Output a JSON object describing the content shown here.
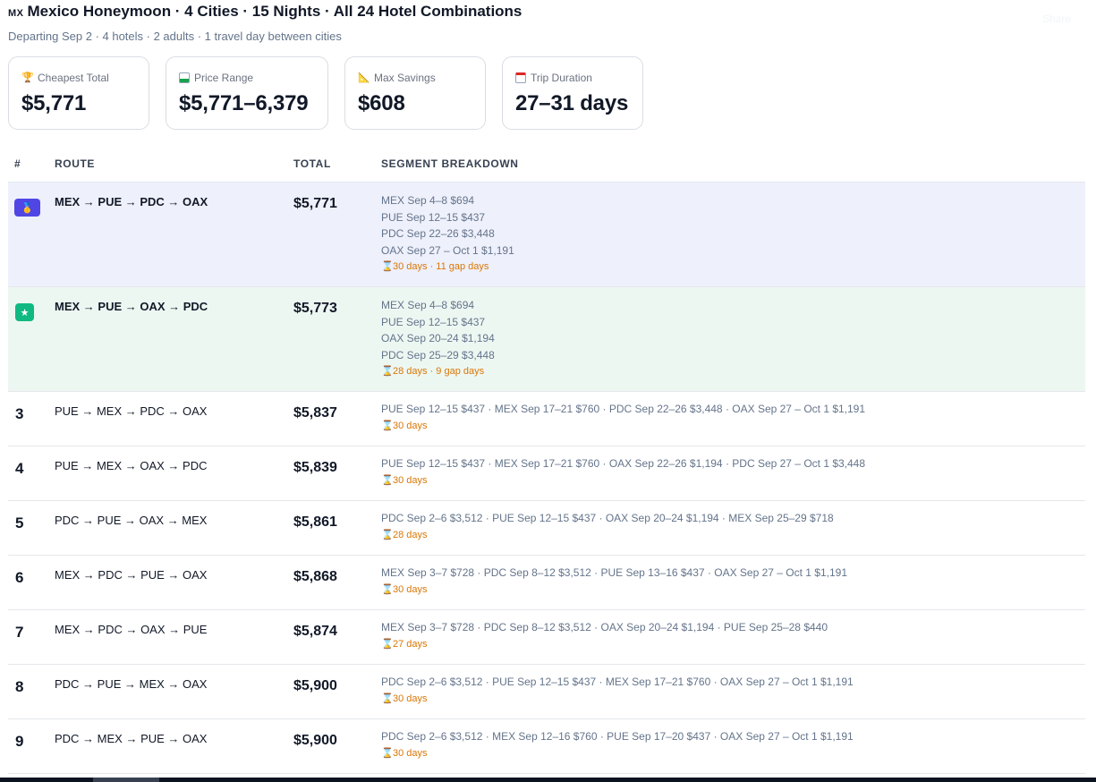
{
  "header": {
    "flag": "MX",
    "title": "Mexico Honeymoon · 4 Cities · 15 Nights · All 24 Hotel Combinations",
    "subtitle": "Departing Sep 2 · 4 hotels · 2 adults · 1 travel day between cities",
    "share_label": "Share"
  },
  "stats": [
    {
      "icon": "trophy-icon",
      "label": "Cheapest Total",
      "value": "$5,771"
    },
    {
      "icon": "bar-chart-icon",
      "label": "Price Range",
      "value": "$5,771–6,379"
    },
    {
      "icon": "ruler-icon",
      "label": "Max Savings",
      "value": "$608"
    },
    {
      "icon": "calendar-icon",
      "label": "Trip Duration",
      "value": "27–31 days"
    }
  ],
  "table": {
    "columns": {
      "rank": "#",
      "route": "ROUTE",
      "total": "TOTAL",
      "segments": "SEGMENT BREAKDOWN"
    },
    "rows": [
      {
        "rank": "1",
        "badge": "medal-icon",
        "route": "MEX → PUE → PDC → OAX",
        "total": "$5,771",
        "segments": [
          "MEX Sep 4–8 $694",
          "PUE Sep 12–15 $437",
          "PDC Sep 22–26 $3,448",
          "OAX Sep 27 – Oct 1 $1,191"
        ],
        "duration": "30 days · 11 gap days"
      },
      {
        "rank": "2",
        "badge": "star-icon",
        "route": "MEX → PUE → OAX → PDC",
        "total": "$5,773",
        "segments": [
          "MEX Sep 4–8 $694",
          "PUE Sep 12–15 $437",
          "OAX Sep 20–24 $1,194",
          "PDC Sep 25–29 $3,448"
        ],
        "duration": "28 days · 9 gap days"
      },
      {
        "rank": "3",
        "route": "PUE → MEX → PDC → OAX",
        "total": "$5,837",
        "segments_line": "PUE Sep 12–15 $437 · MEX Sep 17–21 $760 · PDC Sep 22–26 $3,448 · OAX Sep 27 – Oct 1 $1,191",
        "duration": "30 days"
      },
      {
        "rank": "4",
        "route": "PUE → MEX → OAX → PDC",
        "total": "$5,839",
        "segments_line": "PUE Sep 12–15 $437 · MEX Sep 17–21 $760 · OAX Sep 22–26 $1,194 · PDC Sep 27 – Oct 1 $3,448",
        "duration": "30 days"
      },
      {
        "rank": "5",
        "route": "PDC → PUE → OAX → MEX",
        "total": "$5,861",
        "segments_line": "PDC Sep 2–6 $3,512 · PUE Sep 12–15 $437 · OAX Sep 20–24 $1,194 · MEX Sep 25–29 $718",
        "duration": "28 days"
      },
      {
        "rank": "6",
        "route": "MEX → PDC → PUE → OAX",
        "total": "$5,868",
        "segments_line": "MEX Sep 3–7 $728 · PDC Sep 8–12 $3,512 · PUE Sep 13–16 $437 · OAX Sep 27 – Oct 1 $1,191",
        "duration": "30 days"
      },
      {
        "rank": "7",
        "route": "MEX → PDC → OAX → PUE",
        "total": "$5,874",
        "segments_line": "MEX Sep 3–7 $728 · PDC Sep 8–12 $3,512 · OAX Sep 20–24 $1,194 · PUE Sep 25–28 $440",
        "duration": "27 days"
      },
      {
        "rank": "8",
        "route": "PDC → PUE → MEX → OAX",
        "total": "$5,900",
        "segments_line": "PDC Sep 2–6 $3,512 · PUE Sep 12–15 $437 · MEX Sep 17–21 $760 · OAX Sep 27 – Oct 1 $1,191",
        "duration": "30 days"
      },
      {
        "rank": "9",
        "route": "PDC → MEX → PUE → OAX",
        "total": "$5,900",
        "segments_line": "PDC Sep 2–6 $3,512 · MEX Sep 12–16 $760 · PUE Sep 17–20 $437 · OAX Sep 27 – Oct 1 $1,191",
        "duration": "30 days"
      }
    ]
  }
}
